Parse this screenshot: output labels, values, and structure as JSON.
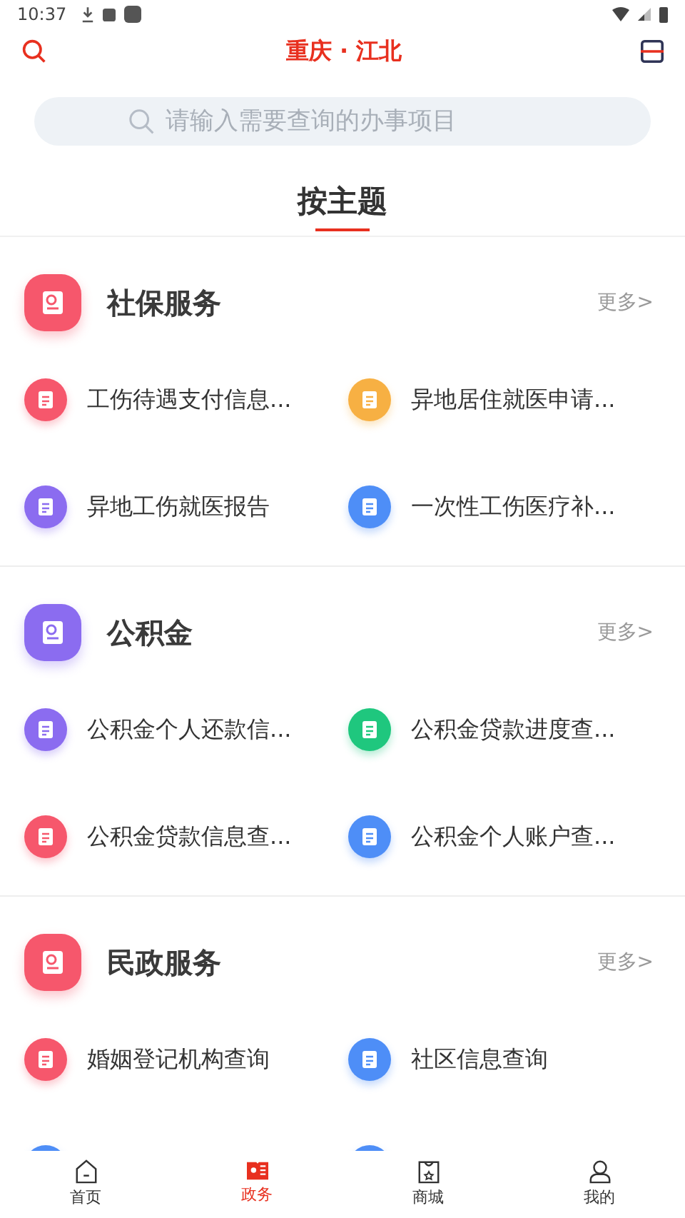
{
  "status_bar": {
    "time": "10:37"
  },
  "header": {
    "title": "重庆 · 江北"
  },
  "search": {
    "placeholder": "请输入需要查询的办事项目"
  },
  "theme_tab": {
    "label": "按主题"
  },
  "sections": [
    {
      "title": "社保服务",
      "more": "更多>",
      "color": "#f6576c",
      "items": [
        {
          "label": "工伤待遇支付信息...",
          "color": "#f6576c"
        },
        {
          "label": "异地居住就医申请...",
          "color": "#f7b043"
        },
        {
          "label": "异地工伤就医报告",
          "color": "#8b6cf0"
        },
        {
          "label": "一次性工伤医疗补...",
          "color": "#4e8ef7"
        }
      ]
    },
    {
      "title": "公积金",
      "more": "更多>",
      "color": "#8b6cf0",
      "items": [
        {
          "label": "公积金个人还款信...",
          "color": "#8b6cf0"
        },
        {
          "label": "公积金贷款进度查...",
          "color": "#1fc77e"
        },
        {
          "label": "公积金贷款信息查...",
          "color": "#f6576c"
        },
        {
          "label": "公积金个人账户查...",
          "color": "#4e8ef7"
        }
      ]
    },
    {
      "title": "民政服务",
      "more": "更多>",
      "color": "#f6576c",
      "items": [
        {
          "label": "婚姻登记机构查询",
          "color": "#f6576c"
        },
        {
          "label": "社区信息查询",
          "color": "#4e8ef7"
        },
        {
          "color": "#4e8ef7"
        },
        {
          "color": "#4e8ef7"
        }
      ]
    }
  ],
  "bottom_nav": [
    {
      "label": "首页",
      "selected": false
    },
    {
      "label": "政务",
      "selected": true
    },
    {
      "label": "商城",
      "selected": false
    },
    {
      "label": "我的",
      "selected": false
    }
  ]
}
